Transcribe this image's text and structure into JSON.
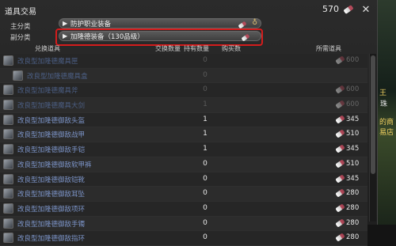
{
  "window": {
    "title": "道具交易",
    "currency_amount": "570"
  },
  "filters": {
    "main_label": "主分类",
    "main_value": "防护职业装备",
    "sub_label": "副分类",
    "sub_value": "加隆德装备（130品级）"
  },
  "columns": [
    "兑换道具",
    "交换数量",
    "持有数量",
    "购买数",
    "所需道具"
  ],
  "rows": [
    {
      "name": "改良型加隆德魔具匣",
      "qty": "0",
      "price": "600",
      "dim": true,
      "sub": false
    },
    {
      "name": "改良型加隆德魔具盒",
      "qty": "0",
      "price": "",
      "dim": true,
      "sub": true
    },
    {
      "name": "改良型加隆德魔具斧",
      "qty": "0",
      "price": "600",
      "dim": true,
      "sub": false
    },
    {
      "name": "改良型加隆德魔具大剑",
      "qty": "1",
      "price": "600",
      "dim": true,
      "sub": false
    },
    {
      "name": "改良型加隆德御敌头盔",
      "qty": "1",
      "price": "345",
      "dim": false,
      "sub": false
    },
    {
      "name": "改良型加隆德御敌战甲",
      "qty": "1",
      "price": "510",
      "dim": false,
      "sub": false
    },
    {
      "name": "改良型加隆德御敌手铠",
      "qty": "1",
      "price": "345",
      "dim": false,
      "sub": false
    },
    {
      "name": "改良型加隆德御敌软甲裤",
      "qty": "0",
      "price": "510",
      "dim": false,
      "sub": false
    },
    {
      "name": "改良型加隆德御敌铠靴",
      "qty": "0",
      "price": "345",
      "dim": false,
      "sub": false
    },
    {
      "name": "改良型加隆德御敌耳坠",
      "qty": "0",
      "price": "280",
      "dim": false,
      "sub": false
    },
    {
      "name": "改良型加隆德御敌项环",
      "qty": "0",
      "price": "280",
      "dim": false,
      "sub": false
    },
    {
      "name": "改良型加隆德御敌手镯",
      "qty": "0",
      "price": "280",
      "dim": false,
      "sub": false
    },
    {
      "name": "改良型加隆德御敌指环",
      "qty": "0",
      "price": "280",
      "dim": false,
      "sub": false
    }
  ],
  "side_text": [
    "王",
    "珠",
    "的商",
    "易店"
  ]
}
